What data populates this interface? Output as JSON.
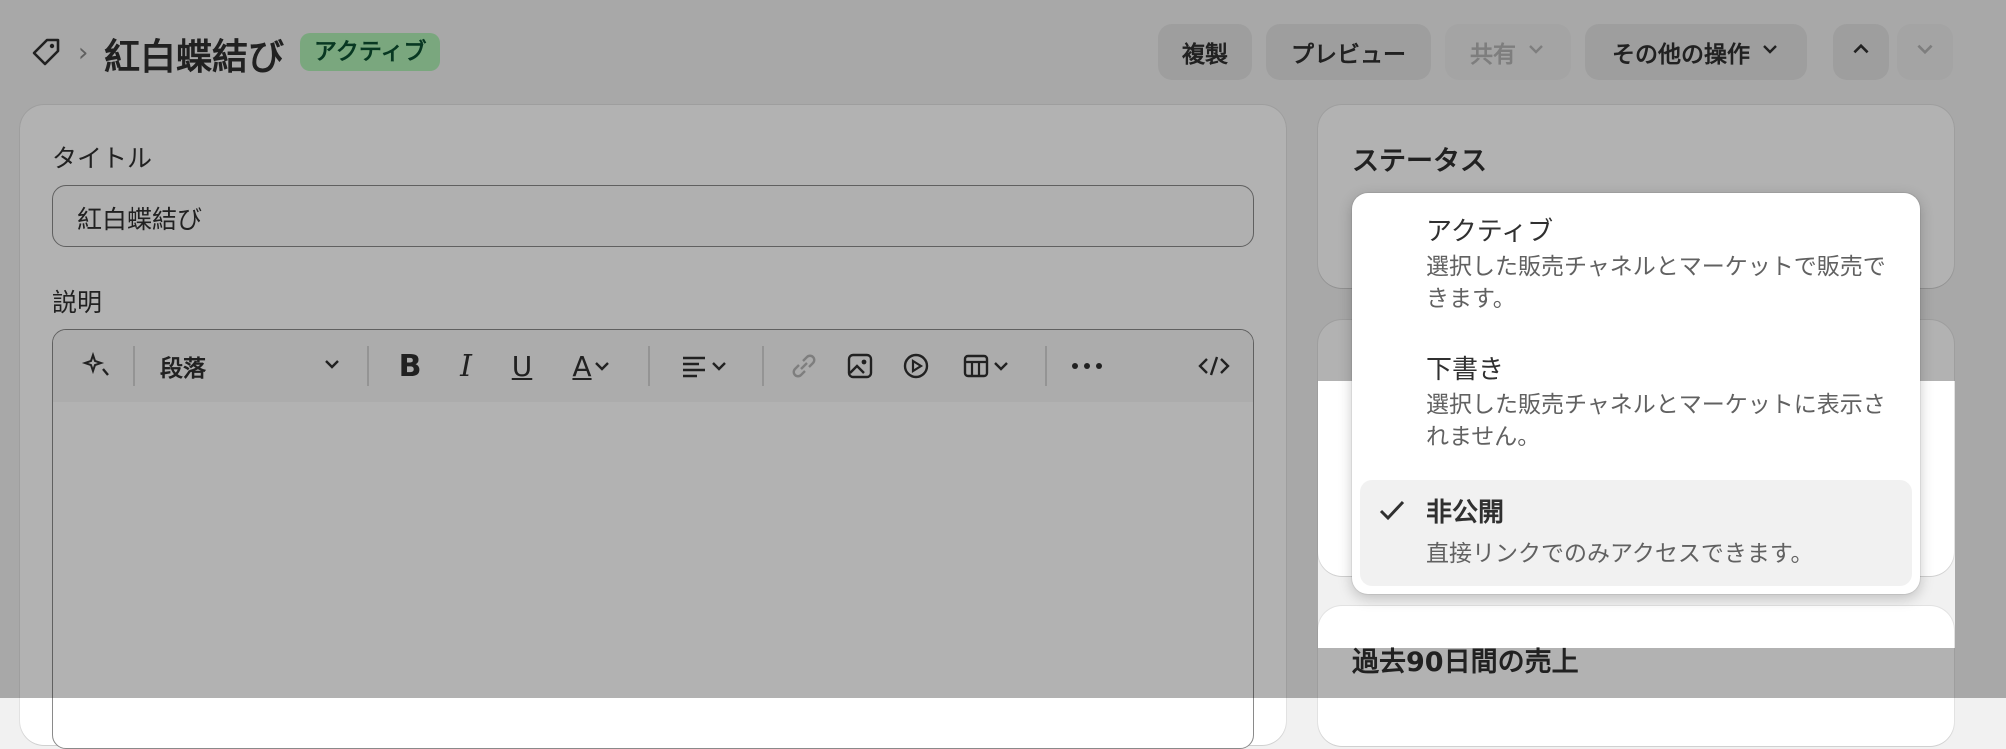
{
  "header": {
    "title": "紅白蝶結び",
    "status_badge": "アクティブ",
    "buttons": {
      "duplicate": "複製",
      "preview": "プレビュー",
      "share": "共有",
      "more_actions": "その他の操作"
    }
  },
  "main": {
    "title_label": "タイトル",
    "title_value": "紅白蝶結び",
    "description_label": "説明",
    "editor": {
      "paragraph_select": "段落"
    }
  },
  "sidebar": {
    "status_heading": "ステータス",
    "sales_heading": "過去90日間の売上"
  },
  "status_menu": {
    "options": [
      {
        "label": "アクティブ",
        "description": "選択した販売チャネルとマーケットで販売できます。",
        "selected": false
      },
      {
        "label": "下書き",
        "description": "選択した販売チャネルとマーケットに表示されません。",
        "selected": false
      },
      {
        "label": "非公開",
        "description": "直接リンクでのみアクセスできます。",
        "selected": true
      }
    ]
  },
  "colors": {
    "badge_bg": "#aff0b5",
    "badge_text": "#0c5132",
    "selected_option_bg": "#f1f1f1"
  }
}
